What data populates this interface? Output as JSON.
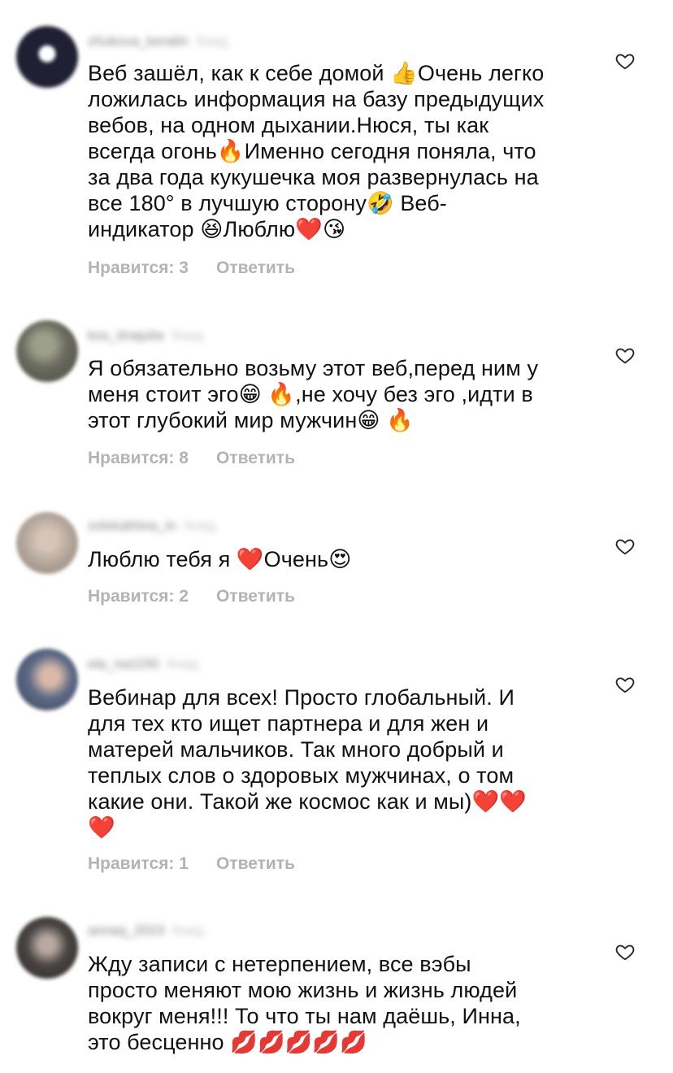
{
  "heart_icon": "heart-outline-icon",
  "comments": [
    {
      "username": "zhukova_keratin",
      "age": "6нед.",
      "avatar_color": "#1f2033",
      "text": "Веб зашёл, как к себе домой 👍Очень легко\nложилась информация на базу предыдущих\nвебов, на одном дыхании.Нюся, ты как\nвсегда огонь🔥Именно сегодня поняла, что\nза два года кукушечка моя развернулась на\nвсе 180° в лучшую сторону🤣 Веб-\nиндикатор 😆Люблю❤️😘",
      "likes": "Нравится: 3",
      "reply": "Ответить"
    },
    {
      "username": "kos_tinajulia",
      "age": "6нед.",
      "avatar_color": "#6b6a5e",
      "text": "Я обязательно возьму этот веб,перед ним у\nменя стоит эго😁 🔥,не хочу без эго ,идти в\nэтот глубокий мир мужчин😁 🔥",
      "likes": "Нравится: 8",
      "reply": "Ответить"
    },
    {
      "username": "zolotukhina_in",
      "age": "6нед.",
      "avatar_color": "#b5a79c",
      "text": "Люблю тебя я ❤️Очень😍",
      "likes": "Нравится: 2",
      "reply": "Ответить"
    },
    {
      "username": "ela_na1150",
      "age": "6нед.",
      "avatar_color": "#5d6a87",
      "text": "Вебинар для всех! Просто глобальный. И\nдля тех кто ищет партнера и для жен и\nматерей мальчиков. Так много добрый и\nтеплых слов о здоровых мужчинах, о том\nкакие они. Такой же космос как и мы)❤️❤️\n❤️",
      "likes": "Нравится: 1",
      "reply": "Ответить"
    },
    {
      "username": "annaq_2023",
      "age": "6нед.",
      "avatar_color": "#4a4543",
      "text": "Жду записи с нетерпением, все вэбы\nпросто меняют мою жизнь и жизнь людей\nвокруг меня!!! То что ты нам даёшь, Инна,\nэто бесценно 💋💋💋💋💋",
      "likes": "",
      "reply": ""
    }
  ]
}
